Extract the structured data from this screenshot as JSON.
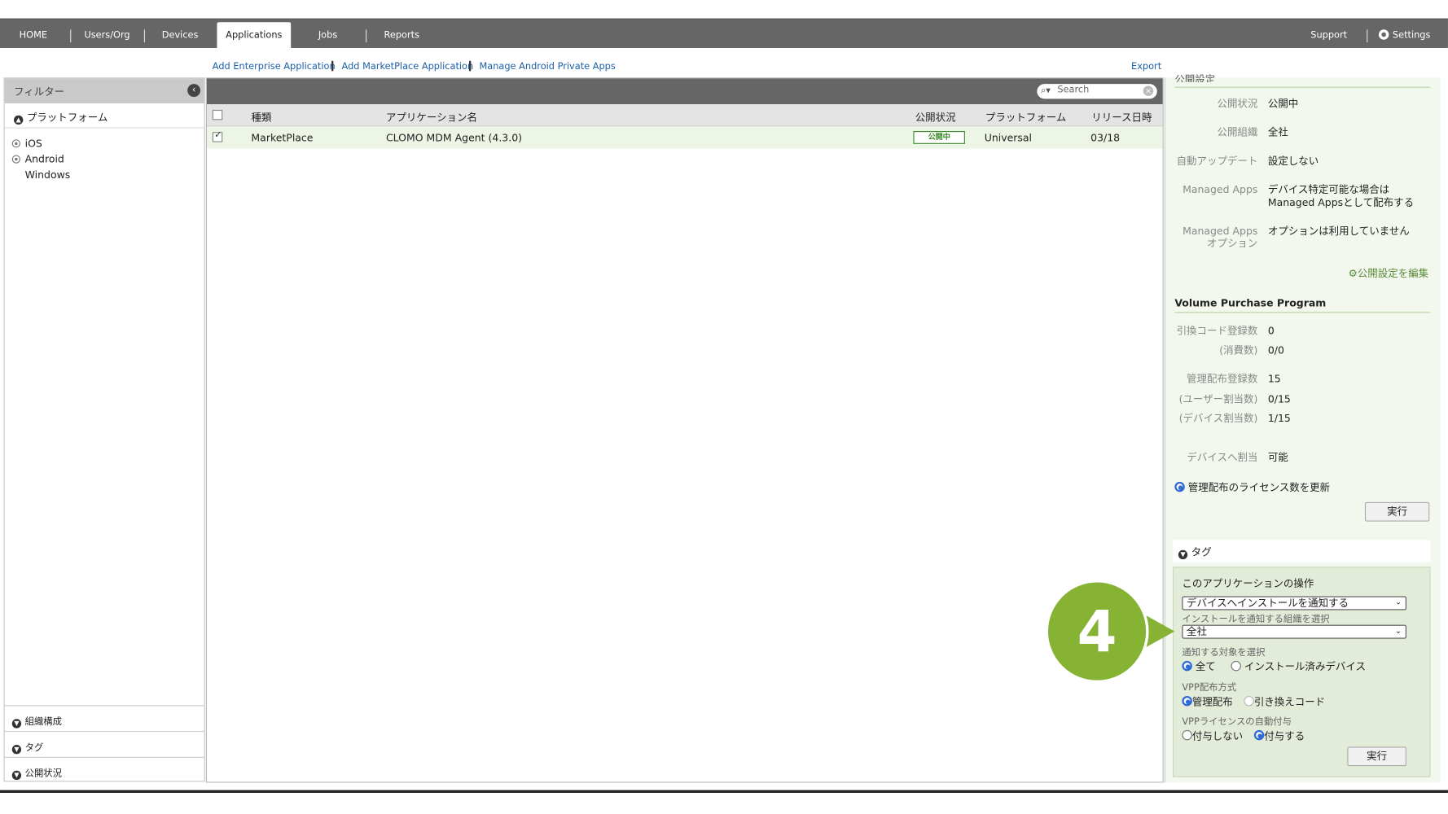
{
  "nav": {
    "tabs": [
      "HOME",
      "Users/Org",
      "Devices",
      "Applications",
      "Jobs",
      "Reports"
    ],
    "active_tab": "Applications",
    "support": "Support",
    "settings": "Settings"
  },
  "links": {
    "add_enterprise": "Add Enterprise Application",
    "add_marketplace": "Add MarketPlace Application",
    "manage_android": "Manage Android Private Apps",
    "export": "Export"
  },
  "filter": {
    "title": "フィルター",
    "platform_section": "プラットフォーム",
    "platforms": [
      "iOS",
      "Android",
      "Windows"
    ],
    "org_section": "組織構成",
    "tag_section": "タグ",
    "status_section": "公開状況"
  },
  "search": {
    "placeholder": "Search"
  },
  "table": {
    "headers": [
      "種類",
      "アプリケーション名",
      "公開状況",
      "プラットフォーム",
      "リリース日時"
    ],
    "rows": [
      {
        "type": "MarketPlace",
        "name": "CLOMO MDM Agent (4.3.0)",
        "status": "公開中",
        "platform": "Universal",
        "release": "03/18",
        "checked": true
      }
    ]
  },
  "publish": {
    "header_partial": "公開設定",
    "status_label": "公開状況",
    "status_value": "公開中",
    "org_label": "公開組織",
    "org_value": "全社",
    "auto_update_label": "自動アップデート",
    "auto_update_value": "設定しない",
    "managed_label": "Managed Apps",
    "managed_value_1": "デバイス特定可能な場合は",
    "managed_value_2": "Managed Appsとして配布する",
    "managed_opt_label_1": "Managed Apps",
    "managed_opt_label_2": "オプション",
    "managed_opt_value": "オプションは利用していません",
    "edit_link": "公開設定を編集"
  },
  "vpp": {
    "title": "Volume Purchase Program",
    "code_count_label": "引換コード登録数",
    "code_count_value": "0",
    "consumed_label": "(消費数)",
    "consumed_value": "0/0",
    "managed_count_label": "管理配布登録数",
    "managed_count_value": "15",
    "user_assign_label": "(ユーザー割当数)",
    "user_assign_value": "0/15",
    "device_assign_label": "(デバイス割当数)",
    "device_assign_value": "1/15",
    "device_allow_label": "デバイスへ割当",
    "device_allow_value": "可能",
    "update_option": "管理配布のライセンス数を更新",
    "run": "実行"
  },
  "tags": {
    "title": "タグ"
  },
  "ops": {
    "title": "このアプリケーションの操作",
    "action_select": "デバイスへインストールを通知する",
    "org_select_label": "インストールを通知する組織を選択",
    "org_select": "全社",
    "target_label": "通知する対象を選択",
    "target_all": "全て",
    "target_installed": "インストール済みデバイス",
    "vpp_method_label": "VPP配布方式",
    "vpp_managed": "管理配布",
    "vpp_code": "引き換えコード",
    "vpp_auto_label": "VPPライセンスの自動付与",
    "auto_no": "付与しない",
    "auto_yes": "付与する",
    "run": "実行"
  },
  "callout": {
    "number": "4",
    "color": "#86b333"
  }
}
